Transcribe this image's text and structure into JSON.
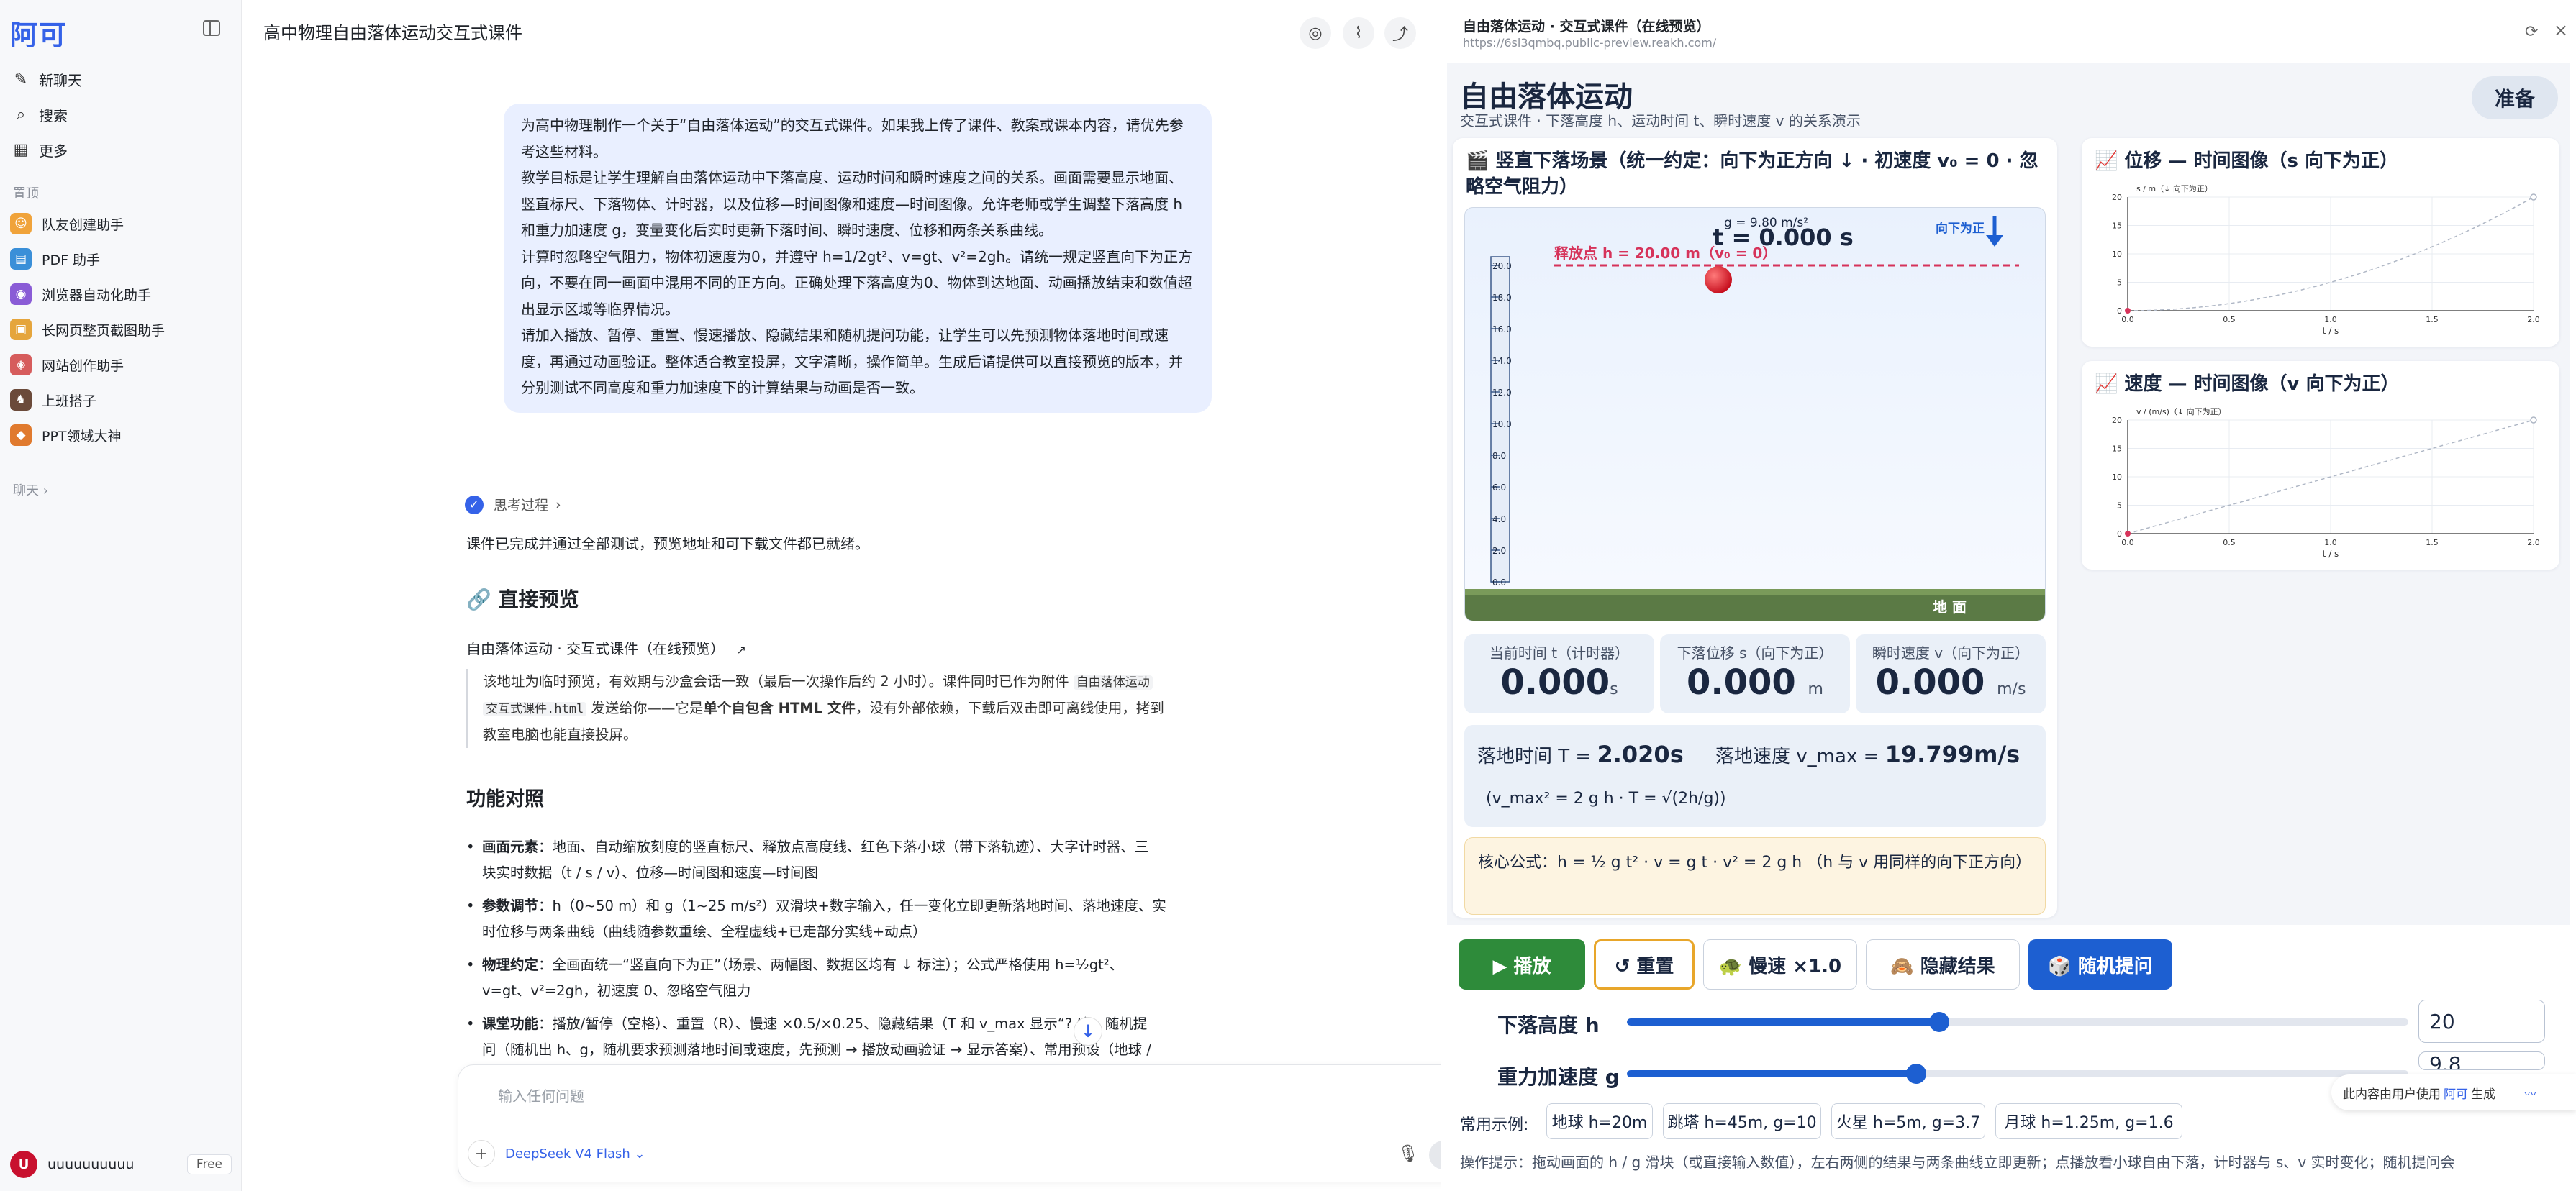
{
  "sidebar": {
    "logo": "阿可",
    "nav": [
      {
        "label": "新聊天",
        "icon": "edit-icon"
      },
      {
        "label": "搜索",
        "icon": "search-icon"
      },
      {
        "label": "更多",
        "icon": "grid-icon"
      }
    ],
    "pinned_label": "置顶",
    "bots": [
      {
        "label": "队友创建助手",
        "color": "#f0a33a"
      },
      {
        "label": "PDF 助手",
        "color": "#3a8fd8"
      },
      {
        "label": "浏览器自动化助手",
        "color": "#8a5cd6"
      },
      {
        "label": "长网页整页截图助手",
        "color": "#e5a53c"
      },
      {
        "label": "网站创作助手",
        "color": "#d65c5c"
      },
      {
        "label": "上班搭子",
        "color": "#6b4a3a"
      },
      {
        "label": "PPT领域大神",
        "color": "#e07a2e"
      }
    ],
    "chats_label": "聊天",
    "user": {
      "avatar": "U",
      "name": "uuuuuuuuuu",
      "plan": "Free"
    }
  },
  "chat": {
    "title": "高中物理自由落体运动交互式课件",
    "user_message": [
      "为高中物理制作一个关于“自由落体运动”的交互式课件。如果我上传了课件、教案或课本内容，请优先参考这些材料。",
      "教学目标是让学生理解自由落体运动中下落高度、运动时间和瞬时速度之间的关系。画面需要显示地面、竖直标尺、下落物体、计时器，以及位移—时间图像和速度—时间图像。允许老师或学生调整下落高度 h 和重力加速度 g，变量变化后实时更新下落时间、瞬时速度、位移和两条关系曲线。",
      "计算时忽略空气阻力，物体初速度为0，并遵守 h=1/2gt²、v=gt、v²=2gh。请统一规定竖直向下为正方向，不要在同一画面中混用不同的正方向。正确处理下落高度为0、物体到达地面、动画播放结束和数值超出显示区域等临界情况。",
      "请加入播放、暂停、重置、慢速播放、隐藏结果和随机提问功能，让学生可以先预测物体落地时间或速度，再通过动画验证。整体适合教室投屏，文字清晰，操作简单。生成后请提供可以直接预览的版本，并分别测试不同高度和重力加速度下的计算结果与动画是否一致。"
    ],
    "thinking_label": "思考过程",
    "done_text": "课件已完成并通过全部测试，预览地址和可下载文件都已就绪。",
    "preview_heading": "直接预览",
    "preview_link": "自由落体运动 · 交互式课件（在线预览）",
    "quote_lines": [
      {
        "a": "该地址为临时预览，有效期与沙盒会话一致（最后一次操作后约 2 小时）。课件同时已作为附件 ",
        "code": "自由落体运动"
      },
      {
        "code": "交互式课件.html",
        "a": " 发送给你——它是",
        "b": "单个自包含 HTML 文件",
        "c": "，没有外部依赖，下载后双击即可离线使用，拷到"
      },
      {
        "a": "教室电脑也能直接投屏。"
      }
    ],
    "features_heading": "功能对照",
    "features": [
      {
        "b": "画面元素",
        "a": "：地面、自动缩放刻度的竖直标尺、释放点高度线、红色下落小球（带下落轨迹）、大字计时器、三",
        "a2": "块实时数据（t / s / v）、位移—时间图和速度—时间图"
      },
      {
        "b": "参数调节",
        "a": "：h（0~50 m）和 g（1~25 m/s²）双滑块+数字输入，任一变化立即更新落地时间、落地速度、实",
        "a2": "时位移与两条曲线（曲线随参数重绘、全程虚线+已走部分实线+动点）"
      },
      {
        "b": "物理约定",
        "a": "：全画面统一“竖直向下为正”（场景、两幅图、数据区均有 ↓ 标注）；公式严格使用 h=½gt²、",
        "a2": "v=gt、v²=2gh，初速度 0、忽略空气阻力"
      },
      {
        "b": "课堂功能",
        "a": "：播放/暂停（空格）、重置（R）、慢速 ×0.5/×0.25、隐藏结果（T 和 v_max 显示“? ”）、随机提",
        "a2": "问（随机出 h、g，随机要求预测落地时间或速度，先预测 → 播放动画验证 → 显示答案）、常用预设（地球 /"
      }
    ],
    "input_placeholder": "输入任何问题",
    "model": "DeepSeek V4 Flash"
  },
  "preview": {
    "title": "自由落体运动 · 交互式课件（在线预览）",
    "url": "https://6sl3qmbq.public-preview.reakh.com/",
    "sim": {
      "title": "自由落体运动",
      "subtitle": "交互式课件 · 下落高度 h、运动时间 t、瞬时速度 v 的关系演示",
      "status": "准备",
      "scene_heading": "🎬 竖直下落场景（统一约定：向下为正方向 ↓ · 初速度 v₀ = 0 · 忽略空气阻力）",
      "scene": {
        "g_label": "g = 9.80 m/s²",
        "timer": "t = 0.000 s",
        "down_label": "向下为正",
        "release_label": "释放点  h = 20.00 m（v₀ = 0）",
        "ground_label": "地 面",
        "ruler_ticks": [
          "20.0",
          "18.0",
          "16.0",
          "14.0",
          "12.0",
          "10.0",
          "8.0",
          "6.0",
          "4.0",
          "2.0",
          "0.0"
        ]
      },
      "stats": [
        {
          "label": "当前时间 t（计时器）",
          "value": "0.000",
          "unit": "s"
        },
        {
          "label": "下落位移 s（向下为正）",
          "value": "0.000",
          "unit": "m"
        },
        {
          "label": "瞬时速度 v（向下为正）",
          "value": "0.000",
          "unit": "m/s"
        }
      ],
      "summary": {
        "t_label": "落地时间 T = ",
        "t_value": "2.020s",
        "v_label": "落地速度 v_max = ",
        "v_value": "19.799m/s",
        "line2": "(v_max² = 2 g h   ·   T = √(2h/g))"
      },
      "formula": "核心公式：h = ½ g t²   ·   v = g t   ·   v² = 2 g h   （h 与 v 用同样的向下正方向）",
      "charts": [
        {
          "heading": "📈 位移 — 时间图像（s 向下为正）",
          "ylabel": "s / m（↓ 向下为正）",
          "xlabel": "t / s",
          "y_ticks": [
            "0",
            "5",
            "10",
            "15",
            "20"
          ],
          "x_ticks": [
            "0.0",
            "0.5",
            "1.0",
            "1.5",
            "2.0"
          ]
        },
        {
          "heading": "📈 速度 — 时间图像（v 向下为正）",
          "ylabel": "v / (m/s)（↓ 向下为正）",
          "xlabel": "t / s",
          "y_ticks": [
            "0",
            "5",
            "10",
            "15",
            "20"
          ],
          "x_ticks": [
            "0.0",
            "0.5",
            "1.0",
            "1.5",
            "2.0"
          ]
        }
      ],
      "buttons": {
        "play": "▶ 播放",
        "reset": "↺ 重置",
        "slow": "🐢 慢速 ×1.0",
        "hide": "🙈 隐藏结果",
        "quiz": "🎲 随机提问"
      },
      "sliders": [
        {
          "label": "下落高度 h",
          "value": "20",
          "fraction": 0.4
        },
        {
          "label": "重力加速度 g",
          "value": "9.8",
          "fraction": 0.37
        }
      ],
      "presets_label": "常用示例:",
      "presets": [
        "地球 h=20m",
        "跳塔 h=45m, g=10",
        "火星 h=5m, g=3.7",
        "月球 h=1.25m, g=1.6"
      ],
      "tip": "操作提示：拖动画面的 h / g 滑块（或直接输入数值），左右两侧的结果与两条曲线立即更新；点播放看小球自由下落，计时器与 s、v 实时变化；随机提问会"
    },
    "generated_badge": {
      "a": "此内容由用户使用",
      "b": "阿可",
      "c": "生成"
    }
  }
}
